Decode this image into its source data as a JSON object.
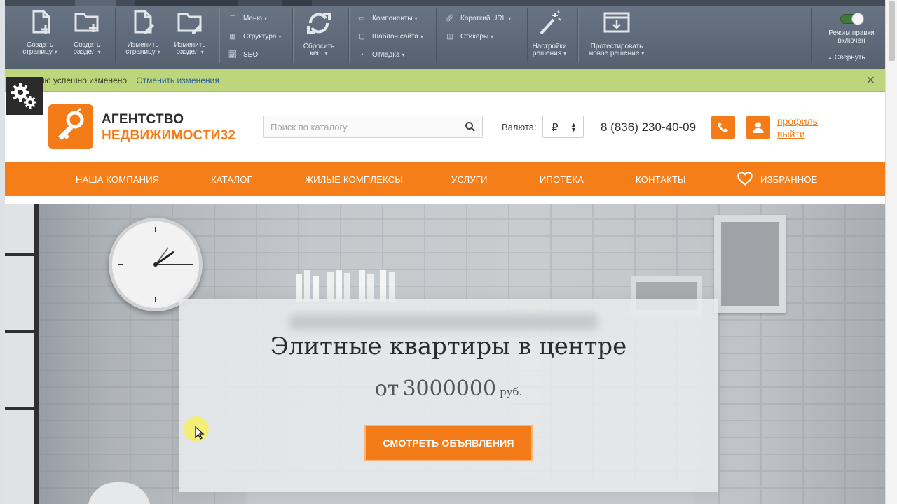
{
  "admin_toolbar": {
    "create_page": [
      "Создать",
      "страницу"
    ],
    "create_section": [
      "Создать",
      "раздел"
    ],
    "edit_page": [
      "Изменить",
      "страницу"
    ],
    "edit_section": [
      "Изменить",
      "раздел"
    ],
    "menu": "Меню",
    "structure": "Структура",
    "seo": "SEO",
    "reset_cache": [
      "Сбросить",
      "кеш"
    ],
    "components": "Компоненты",
    "site_template": "Шаблон сайта",
    "debug": "Отладка",
    "short_url": "Короткий URL",
    "stickers": "Стикеры",
    "solution_settings": [
      "Настройки",
      "решения"
    ],
    "test_solution": [
      "Протестировать",
      "новое решение"
    ],
    "edit_mode": [
      "Режим правки",
      "включен"
    ],
    "collapse": "Свернуть"
  },
  "notification": {
    "text": "ню успешно изменено.",
    "undo_link": "Отменить изменения"
  },
  "header": {
    "logo_line1": "АГЕНТСТВО",
    "logo_line2": "НЕДВИЖИМОСТИ32",
    "search_placeholder": "Поиск по каталогу",
    "currency_label": "Валюта:",
    "currency_value": "₽",
    "phone": "8 (836) 230-40-09",
    "profile_link": "профиль",
    "logout_link": "выйти"
  },
  "nav": {
    "items": [
      "НАША КОМПАНИЯ",
      "КАТАЛОГ",
      "ЖИЛЫЕ КОМПЛЕКСЫ",
      "УСЛУГИ",
      "ИПОТЕКА",
      "КОНТАКТЫ",
      "ИЗБРАННОЕ"
    ]
  },
  "hero": {
    "title": "Элитные квартиры в центре",
    "price_prefix": "от",
    "price_value": "3000000",
    "price_currency": "руб.",
    "button": "СМОТРЕТЬ ОБЪЯВЛЕНИЯ"
  },
  "colors": {
    "accent": "#f47c18",
    "admin_bg": "#5e6a79",
    "notify_bg": "#bdd67b"
  }
}
